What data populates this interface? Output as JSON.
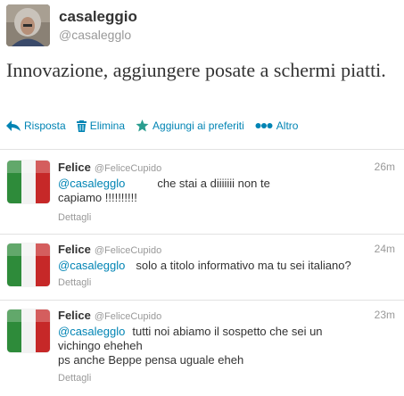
{
  "tweet": {
    "author_name": "casaleggio",
    "author_handle": "@casalegglo",
    "text": "Innovazione, aggiungere posate a schermi piatti."
  },
  "actions": [
    {
      "label": "Risposta",
      "icon": "reply-icon"
    },
    {
      "label": "Elimina",
      "icon": "trash-icon"
    },
    {
      "label": "Aggiungi ai preferiti",
      "icon": "star-icon"
    },
    {
      "label": "Altro",
      "icon": "more-icon"
    }
  ],
  "replies": [
    {
      "name": "Felice",
      "handle": "@FeliceCupido",
      "time": "26m",
      "mention": "@casalegglo",
      "text_line1": "che stai a diiiiiii  non te",
      "text_line2": "capiamo !!!!!!!!!!",
      "details": "Dettagli"
    },
    {
      "name": "Felice",
      "handle": "@FeliceCupido",
      "time": "24m",
      "mention": "@casalegglo",
      "text_line1": "solo a titolo informativo ma tu sei italiano?",
      "text_line2": "",
      "details": "Dettagli"
    },
    {
      "name": "Felice",
      "handle": "@FeliceCupido",
      "time": "23m",
      "mention": "@casalegglo",
      "text_line1": "tutti noi abiamo il sospetto che sei un",
      "text_line2": "vichingo eheheh",
      "text_line3": "ps anche Beppe pensa uguale eheh",
      "details": "Dettagli"
    }
  ],
  "colors": {
    "link": "#0084b4",
    "muted": "#999999",
    "text": "#333333",
    "flag_green": "#2e8b3a",
    "flag_white": "#f4f4f4",
    "flag_red": "#c62828"
  }
}
